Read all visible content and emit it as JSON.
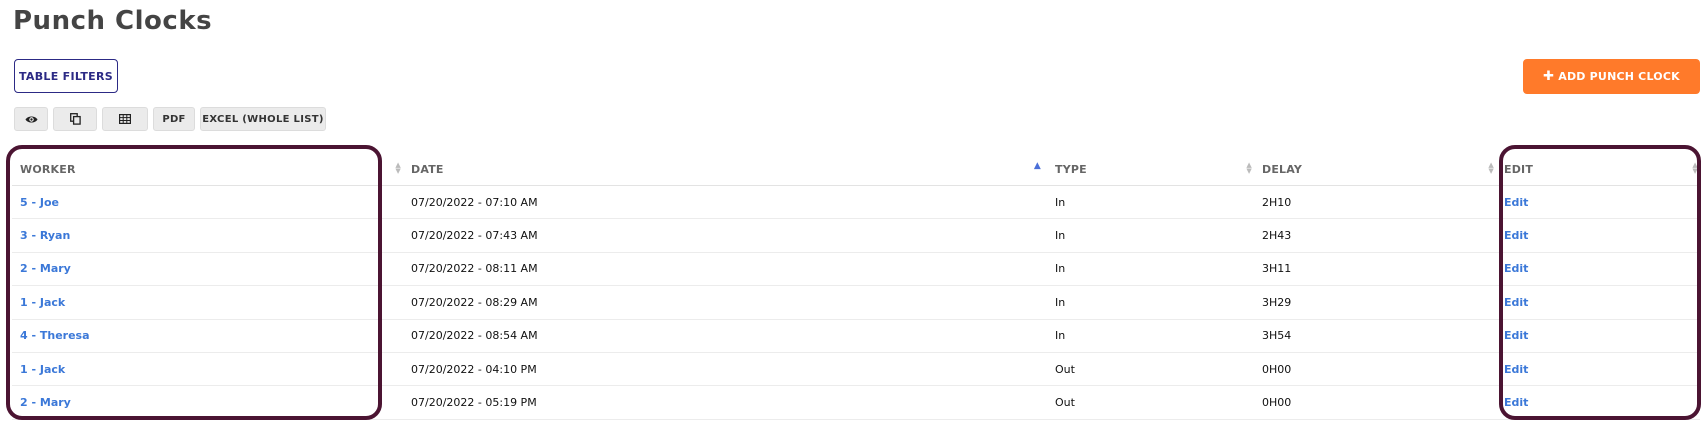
{
  "page": {
    "title": "Punch Clocks"
  },
  "buttons": {
    "table_filters": "TABLE FILTERS",
    "add_punch_clock": "ADD PUNCH CLOCK",
    "add_icon": "plus-icon"
  },
  "toolbar": {
    "view_icon": "eye-icon",
    "copy_icon": "copy-icon",
    "columns_icon": "table-icon",
    "pdf": "PDF",
    "excel": "EXCEL (WHOLE LIST)"
  },
  "table": {
    "columns": [
      "WORKER",
      "DATE",
      "TYPE",
      "DELAY",
      "EDIT"
    ],
    "rows": [
      {
        "worker": "5 - Joe",
        "date": "07/20/2022 - 07:10 AM",
        "type": "In",
        "delay": "2H10",
        "edit": "Edit"
      },
      {
        "worker": "3 - Ryan",
        "date": "07/20/2022 - 07:43 AM",
        "type": "In",
        "delay": "2H43",
        "edit": "Edit"
      },
      {
        "worker": "2 - Mary",
        "date": "07/20/2022 - 08:11 AM",
        "type": "In",
        "delay": "3H11",
        "edit": "Edit"
      },
      {
        "worker": "1 - Jack",
        "date": "07/20/2022 - 08:29 AM",
        "type": "In",
        "delay": "3H29",
        "edit": "Edit"
      },
      {
        "worker": "4 - Theresa",
        "date": "07/20/2022 - 08:54 AM",
        "type": "In",
        "delay": "3H54",
        "edit": "Edit"
      },
      {
        "worker": "1 - Jack",
        "date": "07/20/2022 - 04:10 PM",
        "type": "Out",
        "delay": "0H00",
        "edit": "Edit"
      },
      {
        "worker": "2 - Mary",
        "date": "07/20/2022 - 05:19 PM",
        "type": "Out",
        "delay": "0H00",
        "edit": "Edit"
      }
    ]
  },
  "colors": {
    "accent": "#ff7a2a",
    "link": "#3b78d8",
    "highlight": "#4b1432",
    "filter_border": "#2c2a85"
  }
}
